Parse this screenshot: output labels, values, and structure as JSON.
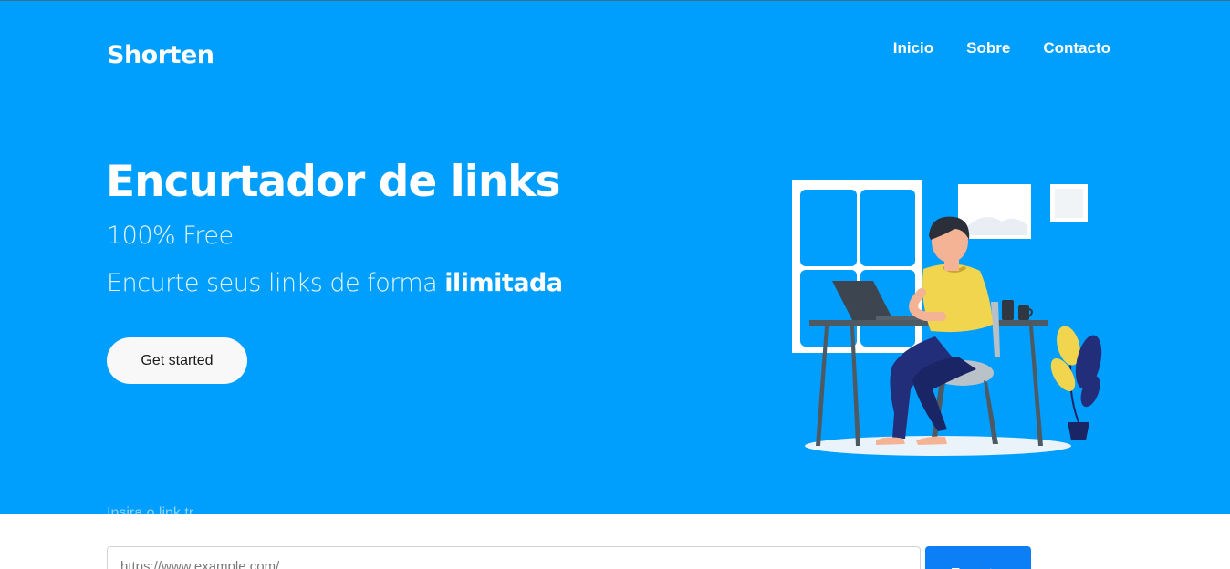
{
  "brand": "Shorten",
  "nav": {
    "items": [
      "Inicio",
      "Sobre",
      "Contacto"
    ]
  },
  "hero": {
    "title": "Encurtador de links",
    "subtitle": "100% Free",
    "tagline_prefix": "Encurte seus links de forma ",
    "tagline_bold": "ilimitada",
    "cta_label": "Get started",
    "partial_label": "Insira o link tr"
  },
  "form": {
    "input_placeholder": "https://www.example.com/",
    "submit_label": "Encurtar"
  },
  "colors": {
    "hero_bg": "#009ffd",
    "button_primary": "#0d7ff6"
  }
}
